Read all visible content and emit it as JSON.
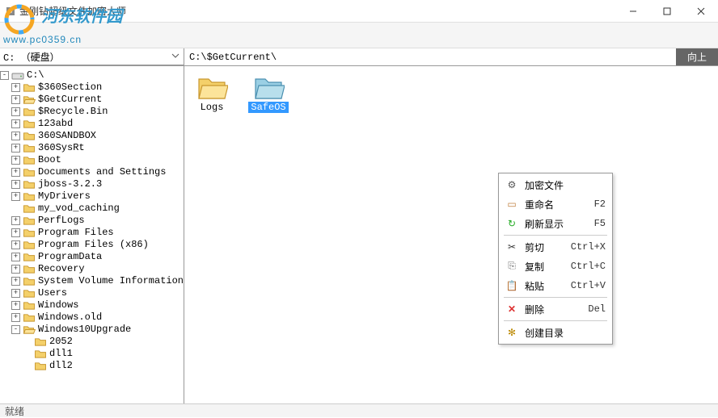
{
  "window": {
    "title": "金刚钻超级文件加密大师"
  },
  "watermark": {
    "line1": "河东软件园",
    "line2": "www.pc0359.cn"
  },
  "pathbar": {
    "drive_label": "C: （硬盘）",
    "path_value": "C:\\$GetCurrent\\",
    "up_label": "向上"
  },
  "tree": {
    "root": "C:\\",
    "items": [
      "$360Section",
      "$GetCurrent",
      "$Recycle.Bin",
      "123abd",
      "360SANDBOX",
      "360SysRt",
      "Boot",
      "Documents and Settings",
      "jboss-3.2.3",
      "MyDrivers",
      "my_vod_caching",
      "PerfLogs",
      "Program Files",
      "Program Files (x86)",
      "ProgramData",
      "Recovery",
      "System Volume Information",
      "Users",
      "Windows",
      "Windows.old",
      "Windows10Upgrade"
    ],
    "win10upgrade_children": [
      "2052",
      "dll1",
      "dll2"
    ]
  },
  "files": {
    "items": [
      {
        "name": "Logs",
        "selected": false,
        "variant": "yellow"
      },
      {
        "name": "SafeOS",
        "selected": true,
        "variant": "blue"
      }
    ]
  },
  "context_menu": {
    "items": [
      {
        "icon": "gears",
        "label": "加密文件",
        "shortcut": ""
      },
      {
        "icon": "rename",
        "label": "重命名",
        "shortcut": "F2"
      },
      {
        "icon": "refresh",
        "label": "刷新显示",
        "shortcut": "F5"
      },
      {
        "sep": true
      },
      {
        "icon": "cut",
        "label": "剪切",
        "shortcut": "Ctrl+X"
      },
      {
        "icon": "copy",
        "label": "复制",
        "shortcut": "Ctrl+C"
      },
      {
        "icon": "paste",
        "label": "粘贴",
        "shortcut": "Ctrl+V"
      },
      {
        "sep": true
      },
      {
        "icon": "delete",
        "label": "删除",
        "shortcut": "Del"
      },
      {
        "sep": true
      },
      {
        "icon": "newfolder",
        "label": "创建目录",
        "shortcut": ""
      }
    ]
  },
  "statusbar": {
    "text": "就绪"
  },
  "colors": {
    "accent": "#3399ff"
  }
}
